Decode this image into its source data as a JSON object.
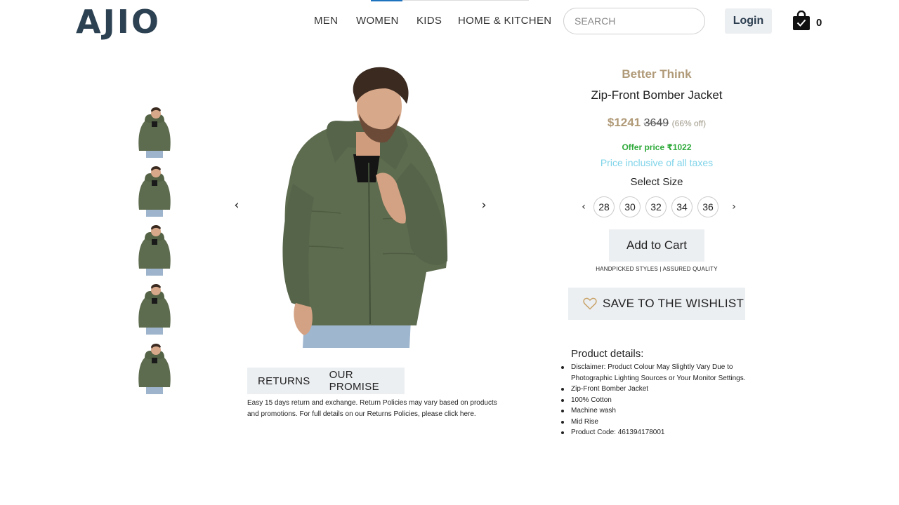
{
  "header": {
    "logo": "AJIO",
    "nav": [
      "MEN",
      "WOMEN",
      "KIDS",
      "HOME & KITCHEN"
    ],
    "search_placeholder": "SEARCH",
    "login_label": "Login",
    "cart_count": "0",
    "cart_icon": "shopping-bag-icon"
  },
  "gallery": {
    "thumbnail_count": 5,
    "prev_arrow": "‹",
    "next_arrow": "›"
  },
  "tabs": {
    "returns_label": "RETURNS",
    "promise_label": "OUR PROMISE",
    "returns_text": "Easy 15 days return and exchange. Return Policies may vary based on products and promotions. For full details on our Returns Policies, please click here."
  },
  "product": {
    "brand": "Better Think",
    "name": "Zip-Front Bomber Jacket",
    "price": "$1241",
    "mrp": "3649",
    "discount": "(66% off)",
    "offer_price": "Offer price ₹1022",
    "tax_note": "Price inclusive of all taxes",
    "select_size_label": "Select Size",
    "sizes": [
      "28",
      "30",
      "32",
      "34",
      "36"
    ],
    "size_prev": "‹",
    "size_next": "›",
    "add_to_cart_label": "Add to Cart",
    "tagline": "HANDPICKED STYLES | ASSURED QUALITY",
    "wishlist_label": "SAVE TO THE WISHLIST",
    "details_title": "Product details:",
    "details": [
      "Disclaimer: Product Colour May Slightly Vary Due to Photographic Lighting Sources or Your Monitor Settings.",
      "Zip-Front Bomber Jacket",
      "100% Cotton",
      "Machine wash",
      "Mid Rise",
      "Product Code: 461394178001"
    ]
  },
  "colors": {
    "logo": "#2c4152",
    "brand_gold": "#b09a78",
    "offer_green": "#2eaa3a",
    "tax_blue": "#7fd3e9",
    "button_bg": "#eceff2",
    "jacket_olive": "#5d6b4e"
  }
}
